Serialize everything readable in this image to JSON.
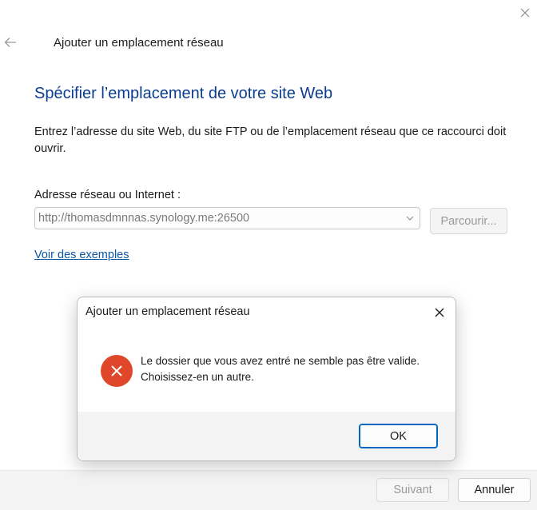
{
  "window": {
    "close_icon": "close-icon",
    "back_icon": "arrow-left-icon",
    "title": "Ajouter un emplacement réseau"
  },
  "page": {
    "heading": "Spécifier l’emplacement de votre site Web",
    "description": "Entrez l’adresse du site Web, du site FTP ou de l’emplacement réseau que ce raccourci doit ouvrir.",
    "address_label": "Adresse réseau ou Internet :",
    "address_value": "http://thomasdmnnas.synology.me:26500",
    "browse_label": "Parcourir...",
    "examples_link": "Voir des exemples"
  },
  "footer": {
    "next_label": "Suivant",
    "cancel_label": "Annuler"
  },
  "dialog": {
    "title": "Ajouter un emplacement réseau",
    "message_line1": "Le dossier que vous avez entré ne semble pas être valide.",
    "message_line2": "Choisissez-en un autre.",
    "ok_label": "OK",
    "icon": "error-icon"
  },
  "colors": {
    "heading": "#0c3c91",
    "link": "#0b57a8",
    "error": "#e0462a",
    "accent": "#0067c0"
  }
}
